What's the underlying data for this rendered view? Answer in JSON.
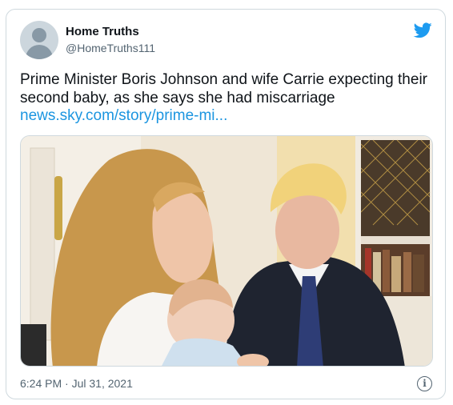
{
  "author": {
    "name": "Home Truths",
    "handle": "@HomeTruths111"
  },
  "tweet": {
    "text": "Prime Minister Boris Johnson and wife Carrie expecting their second baby, as she says she had miscarriage",
    "link": "news.sky.com/story/prime-mi..."
  },
  "meta": {
    "timestamp": "6:24 PM · Jul 31, 2021"
  },
  "icons": {
    "brand": "twitter-bird-icon",
    "info": "info-icon"
  },
  "colors": {
    "link": "#1b95e0",
    "brand": "#1d9bf0",
    "muted": "#536471",
    "border": "#cfd9de"
  }
}
